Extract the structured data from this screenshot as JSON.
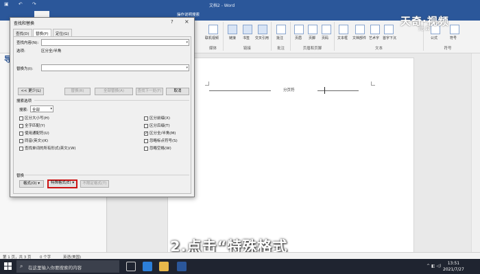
{
  "window": {
    "doc_title": "文档2 - Word",
    "search_hint": "操作说明搜索"
  },
  "ribbon": {
    "groups": [
      {
        "label": "媒体",
        "items": [
          "联机视频"
        ]
      },
      {
        "label": "链接",
        "items": [
          "链接",
          "书签",
          "交叉引用"
        ]
      },
      {
        "label": "批注",
        "items": [
          "批注"
        ]
      },
      {
        "label": "页眉和页脚",
        "items": [
          "页眉",
          "页脚",
          "页码"
        ]
      },
      {
        "label": "文本",
        "items": [
          "文本框",
          "文档部件",
          "艺术字",
          "首字下沉"
        ]
      },
      {
        "label": "符号",
        "items": [
          "公式",
          "符号"
        ]
      }
    ]
  },
  "watermark": {
    "main": "天奇·视频",
    "sub": "元 Ω"
  },
  "nav": {
    "title": "导"
  },
  "document": {
    "page_break_label": "分页符"
  },
  "subtitle": "2.点击“特殊格式",
  "dialog": {
    "title": "查找和替换",
    "help": "?",
    "close": "×",
    "tabs": [
      "查找(D)",
      "替换(P)",
      "定位(G)"
    ],
    "active_tab": 1,
    "find_label": "查找内容(N):",
    "find_value": "",
    "options_label": "选项:",
    "options_value": "区分全/半角",
    "replace_label": "替换为(I):",
    "replace_value": "",
    "buttons": {
      "less": "<< 更少(L)",
      "replace": "替换(R)",
      "replace_all": "全部替换(A)",
      "find_next": "查找下一处(F)",
      "cancel": "取消"
    },
    "search_options_title": "搜索选项",
    "search_label": "搜索:",
    "search_value": "全部",
    "left_checks": [
      {
        "label": "区分大小写(H)",
        "checked": false
      },
      {
        "label": "全字匹配(Y)",
        "checked": false
      },
      {
        "label": "使用通配符(U)",
        "checked": false
      },
      {
        "label": "同音(英文)(K)",
        "checked": false
      },
      {
        "label": "查找单词的所有形式(英文)(W)",
        "checked": false
      }
    ],
    "right_checks": [
      {
        "label": "区分前缀(X)",
        "checked": false
      },
      {
        "label": "区分后缀(T)",
        "checked": false
      },
      {
        "label": "区分全/半角(M)",
        "checked": true
      },
      {
        "label": "忽略标点符号(S)",
        "checked": false
      },
      {
        "label": "忽略空格(W)",
        "checked": false
      }
    ],
    "replace_section": "替换",
    "format_button": "格式(O) ▾",
    "special_button": "特殊格式(E) ▾",
    "no_format_button": "不限定格式(T)"
  },
  "status": {
    "page": "第 1 页，共 3 页",
    "words": "0 个字",
    "lang": "英语(美国)"
  },
  "taskbar": {
    "search_placeholder": "在这里输入你要搜索的内容",
    "time": "13:51",
    "date": "2021/7/27"
  }
}
